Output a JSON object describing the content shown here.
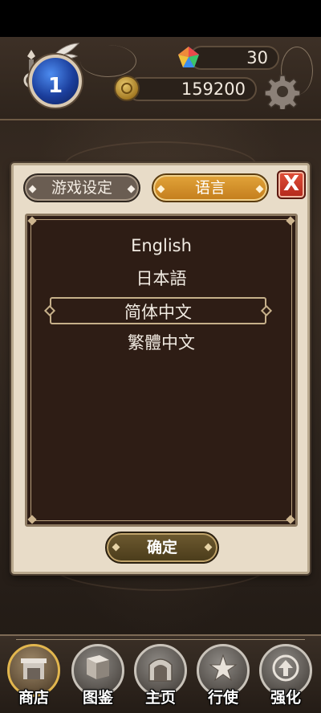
{
  "hud": {
    "level": "1",
    "gems": "30",
    "coins": "159200"
  },
  "dialog": {
    "tabs": [
      {
        "label": "游戏设定",
        "active": false
      },
      {
        "label": "语言",
        "active": true
      }
    ],
    "close_label": "X",
    "languages": [
      {
        "label": "English",
        "selected": false
      },
      {
        "label": "日本語",
        "selected": false
      },
      {
        "label": "简体中文",
        "selected": true
      },
      {
        "label": "繁體中文",
        "selected": false
      }
    ],
    "confirm_label": "确定"
  },
  "nav": {
    "items": [
      {
        "label": "商店",
        "icon": "shop-icon",
        "active": true
      },
      {
        "label": "图鉴",
        "icon": "book-icon",
        "active": false
      },
      {
        "label": "主页",
        "icon": "gate-icon",
        "active": false
      },
      {
        "label": "行使",
        "icon": "star-wings-icon",
        "active": false
      },
      {
        "label": "强化",
        "icon": "arrow-up-icon",
        "active": false
      }
    ]
  },
  "colors": {
    "accent": "#d6952e",
    "close": "#c4341f",
    "panel": "#2e1d15",
    "dialog": "#e8dcc8"
  }
}
